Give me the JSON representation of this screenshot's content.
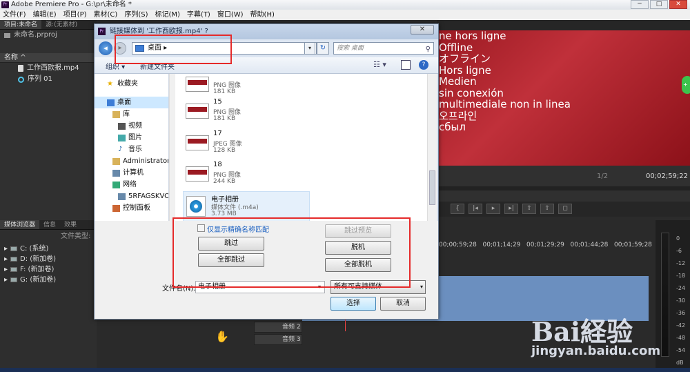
{
  "app": {
    "title": "Adobe Premiere Pro - G:\\pr\\未命名 *",
    "logo_text": "Pr",
    "menu": [
      "文件(F)",
      "编辑(E)",
      "项目(P)",
      "素材(C)",
      "序列(S)",
      "标记(M)",
      "字幕(T)",
      "窗口(W)",
      "帮助(H)"
    ],
    "window_controls": [
      "─",
      "□",
      "✕"
    ]
  },
  "project": {
    "tabs": [
      "项目:未命名",
      "源:(无素材)"
    ],
    "filename": "未命名.prproj",
    "column_name": "名称",
    "items": [
      {
        "name": "工作西欧报.mp4",
        "icon": "video-file-icon"
      },
      {
        "name": "序列 01",
        "icon": "sequence-icon"
      }
    ]
  },
  "media_browser": {
    "tabs": [
      "媒体浏览器",
      "信息",
      "效果"
    ],
    "filter_label": "文件类型:",
    "drives": [
      "C: (系统)",
      "D: (新加卷)",
      "F: (新加卷)",
      "G: (新加卷)"
    ]
  },
  "monitor": {
    "lines": [
      "ne hors ligne",
      "Offline",
      "オフライン",
      "Hors ligne",
      "Medien",
      "sin conexión",
      "multimediale non in linea",
      "오프라인",
      "сбыл"
    ],
    "zoom": "1/2",
    "timecode": "00;02;59;22"
  },
  "timeline": {
    "ruler": [
      "00;00;59;28",
      "00;01;14;29",
      "00;01;29;29",
      "00;01;44;28",
      "00;01;59;28"
    ],
    "audio_tracks": [
      "音频 2",
      "音频 3"
    ]
  },
  "meter": {
    "labels": [
      "0",
      "-6",
      "-12",
      "-18",
      "-24",
      "-30",
      "-36",
      "-42",
      "-48",
      "-54",
      "dB"
    ]
  },
  "dialog": {
    "title": "链接媒体到 '工作西欧报.mp4' ?",
    "address": "桌面",
    "address_arrow": "▸",
    "search_placeholder": "搜索 桌面",
    "toolbar": {
      "organize": "组织 ▾",
      "new_folder": "新建文件夹"
    },
    "nav": [
      {
        "label": "收藏夹",
        "icon": "star-icon",
        "color": "#e8b000"
      },
      {
        "label": "桌面",
        "icon": "desktop-icon",
        "color": "#3d7dd6"
      },
      {
        "label": "库",
        "icon": "library-icon",
        "color": "#d8b25a"
      },
      {
        "label": "视频",
        "icon": "video-folder-icon",
        "color": "#555"
      },
      {
        "label": "图片",
        "icon": "picture-folder-icon",
        "color": "#4aa"
      },
      {
        "label": "音乐",
        "icon": "music-folder-icon",
        "color": "#26a"
      },
      {
        "label": "Administrator",
        "icon": "user-folder-icon",
        "color": "#d8b25a"
      },
      {
        "label": "计算机",
        "icon": "computer-icon",
        "color": "#6789aa"
      },
      {
        "label": "网络",
        "icon": "network-icon",
        "color": "#3a7"
      },
      {
        "label": "5RFAGSKVOX",
        "icon": "network-computer-icon",
        "color": "#6789aa"
      },
      {
        "label": "控制面板",
        "icon": "control-panel-icon",
        "color": "#c63"
      }
    ],
    "files": [
      {
        "name": "",
        "type": "PNG 图像",
        "size": "181 KB"
      },
      {
        "name": "15",
        "type": "PNG 图像",
        "size": "181 KB"
      },
      {
        "name": "17",
        "type": "JPEG 图像",
        "size": "128 KB"
      },
      {
        "name": "18",
        "type": "PNG 图像",
        "size": "244 KB"
      },
      {
        "name": "电子相册",
        "type": "媒体文件 (.m4a)",
        "size": "3.73 MB"
      }
    ],
    "match_checkbox_label": "仅显示精确名称匹配",
    "buttons": {
      "skip": "跳过",
      "skip_all": "全部跳过",
      "skip_preview": "跳过预览",
      "offline": "脱机",
      "offline_all": "全部脱机",
      "select": "选择",
      "cancel": "取消"
    },
    "filename_label": "文件名(N):",
    "filename_value": "电子相册",
    "filetype_value": "所有可支持媒体"
  },
  "watermark": {
    "brand": "Bai経验",
    "url": "jingyan.baidu.com"
  },
  "colors": {
    "accent": "#e52a2a",
    "monitor_red": "#b02530"
  }
}
